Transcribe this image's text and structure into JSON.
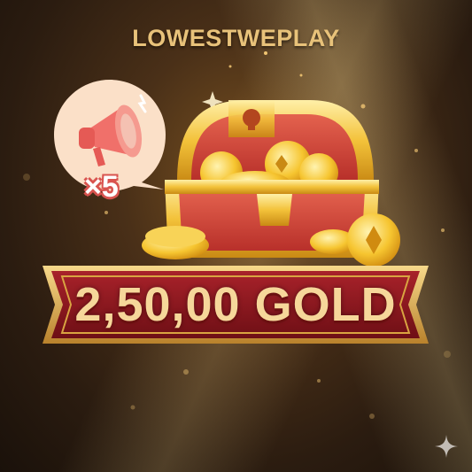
{
  "header": {
    "title": "LOWESTWEPLAY"
  },
  "badge": {
    "icon": "megaphone-icon",
    "multiplier": "×5"
  },
  "reward": {
    "amount_text": "2,50,00 GOLD",
    "icon": "treasure-chest-icon"
  },
  "watermark": {
    "icon": "sparkle-icon"
  },
  "colors": {
    "gold_text": "#e8c27a",
    "banner_red": "#8e1a1f",
    "banner_gold": "#d9a441",
    "badge_bg": "#fbe0c8",
    "megaphone": "#f0706a"
  }
}
